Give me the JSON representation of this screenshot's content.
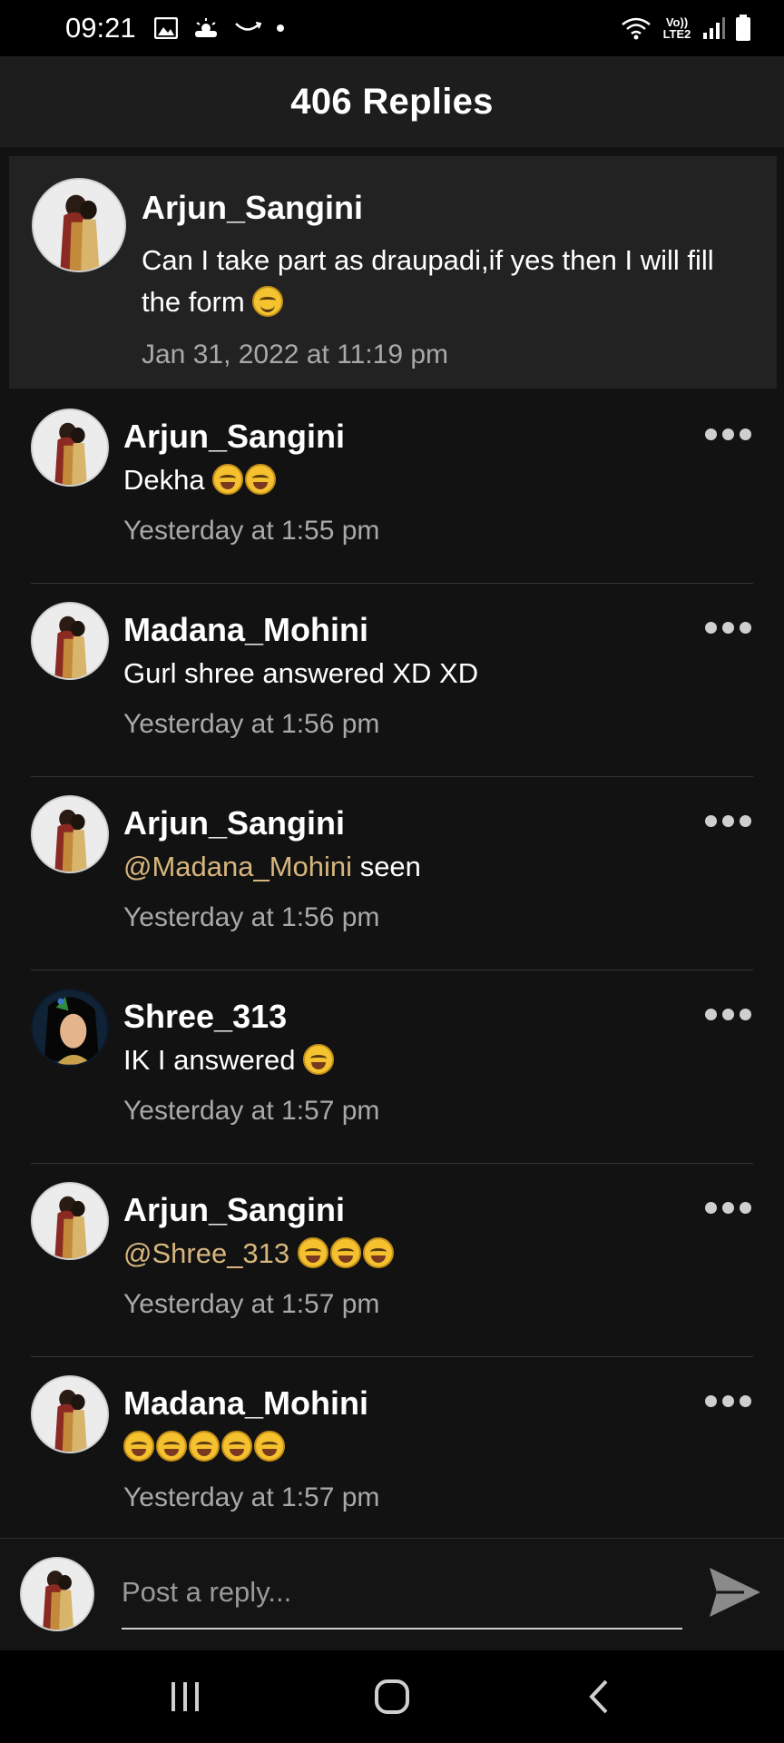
{
  "status_bar": {
    "time": "09:21",
    "network_label": "Vo)) LTE2"
  },
  "header": {
    "title": "406 Replies"
  },
  "parent_comment": {
    "author": "Arjun_Sangini",
    "text": "Can I take part as draupadi,if yes then I will fill the form",
    "time": "Jan 31, 2022 at 11:19 pm"
  },
  "replies": [
    {
      "author": "Arjun_Sangini",
      "mention": "",
      "text": "Dekha",
      "emoji": "laugh-laugh",
      "time": "Yesterday at 1:55 pm"
    },
    {
      "author": "Madana_Mohini",
      "mention": "",
      "text": "Gurl shree answered XD XD",
      "emoji": "",
      "time": "Yesterday at 1:56 pm"
    },
    {
      "author": "Arjun_Sangini",
      "mention": "@Madana_Mohini",
      "text": "seen",
      "emoji": "",
      "time": "Yesterday at 1:56 pm"
    },
    {
      "author": "Shree_313",
      "mention": "",
      "text": "IK I answered",
      "emoji": "grin",
      "time": "Yesterday at 1:57 pm"
    },
    {
      "author": "Arjun_Sangini",
      "mention": "@Shree_313",
      "text": "",
      "emoji": "laugh x3",
      "time": "Yesterday at 1:57 pm"
    },
    {
      "author": "Madana_Mohini",
      "mention": "",
      "text": "",
      "emoji": "laugh x5",
      "time": "Yesterday at 1:57 pm"
    }
  ],
  "reply_bar": {
    "placeholder": "Post a reply..."
  },
  "colors": {
    "background": "#121212",
    "header": "#1d1d1d",
    "parent_bg": "#222222",
    "mention": "#d7b67d",
    "time": "#a9a9a9"
  },
  "icons": [
    "gallery-icon",
    "weather-icon",
    "smile-icon",
    "wifi-icon",
    "signal-icon",
    "battery-icon",
    "more-icon",
    "send-icon",
    "recents-icon",
    "home-icon",
    "back-icon"
  ]
}
